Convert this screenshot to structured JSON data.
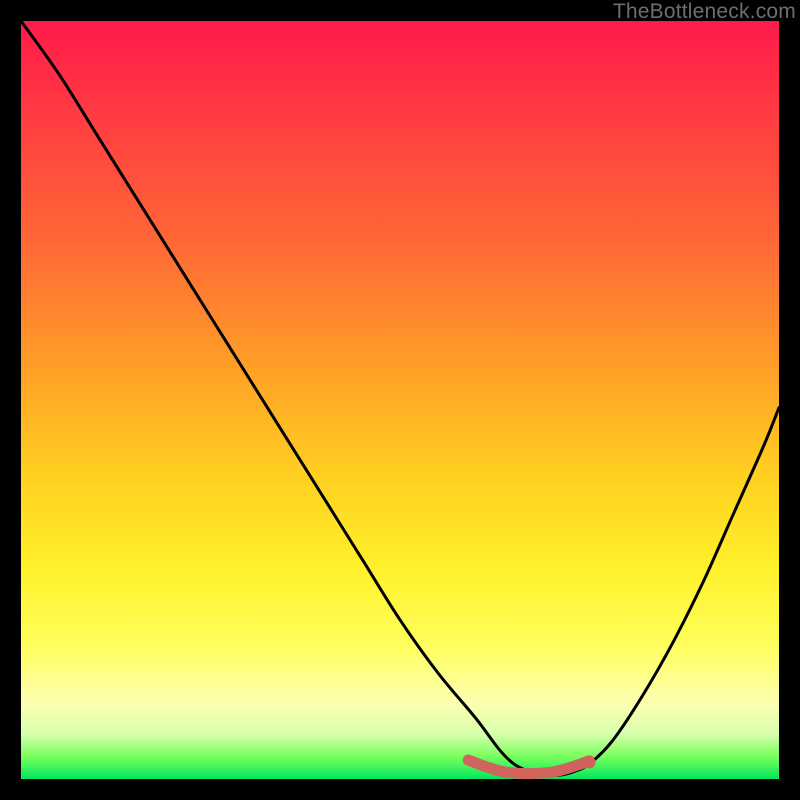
{
  "watermark": "TheBottleneck.com",
  "chart_data": {
    "type": "line",
    "title": "",
    "xlabel": "",
    "ylabel": "",
    "xlim": [
      0,
      100
    ],
    "ylim": [
      0,
      100
    ],
    "grid": false,
    "legend": false,
    "series": [
      {
        "name": "curve",
        "color": "#000000",
        "x": [
          0,
          5,
          10,
          15,
          20,
          25,
          30,
          35,
          40,
          45,
          50,
          55,
          60,
          63,
          65,
          67,
          69,
          71,
          73,
          75,
          78,
          82,
          86,
          90,
          94,
          98,
          100
        ],
        "y": [
          100,
          93,
          85,
          77,
          69,
          61,
          53,
          45,
          37,
          29,
          21,
          14,
          8,
          4,
          2,
          1,
          0.5,
          0.5,
          1,
          2,
          5,
          11,
          18,
          26,
          35,
          44,
          49
        ]
      }
    ],
    "marker_band": {
      "color": "#d0635e",
      "x_start": 59,
      "x_end": 75,
      "y": 1.5,
      "end_dot_x": 75,
      "end_dot_y": 2.2
    },
    "gradient_stops": [
      {
        "pos": 0,
        "color": "#ff1a4b"
      },
      {
        "pos": 12,
        "color": "#ff3a42"
      },
      {
        "pos": 30,
        "color": "#ff6a35"
      },
      {
        "pos": 47,
        "color": "#ffa326"
      },
      {
        "pos": 60,
        "color": "#ffd021"
      },
      {
        "pos": 72,
        "color": "#fff02a"
      },
      {
        "pos": 82,
        "color": "#ffff5a"
      },
      {
        "pos": 90,
        "color": "#fdffb0"
      },
      {
        "pos": 94,
        "color": "#d8ffae"
      },
      {
        "pos": 97,
        "color": "#7bff5e"
      },
      {
        "pos": 100,
        "color": "#00e85c"
      }
    ]
  }
}
